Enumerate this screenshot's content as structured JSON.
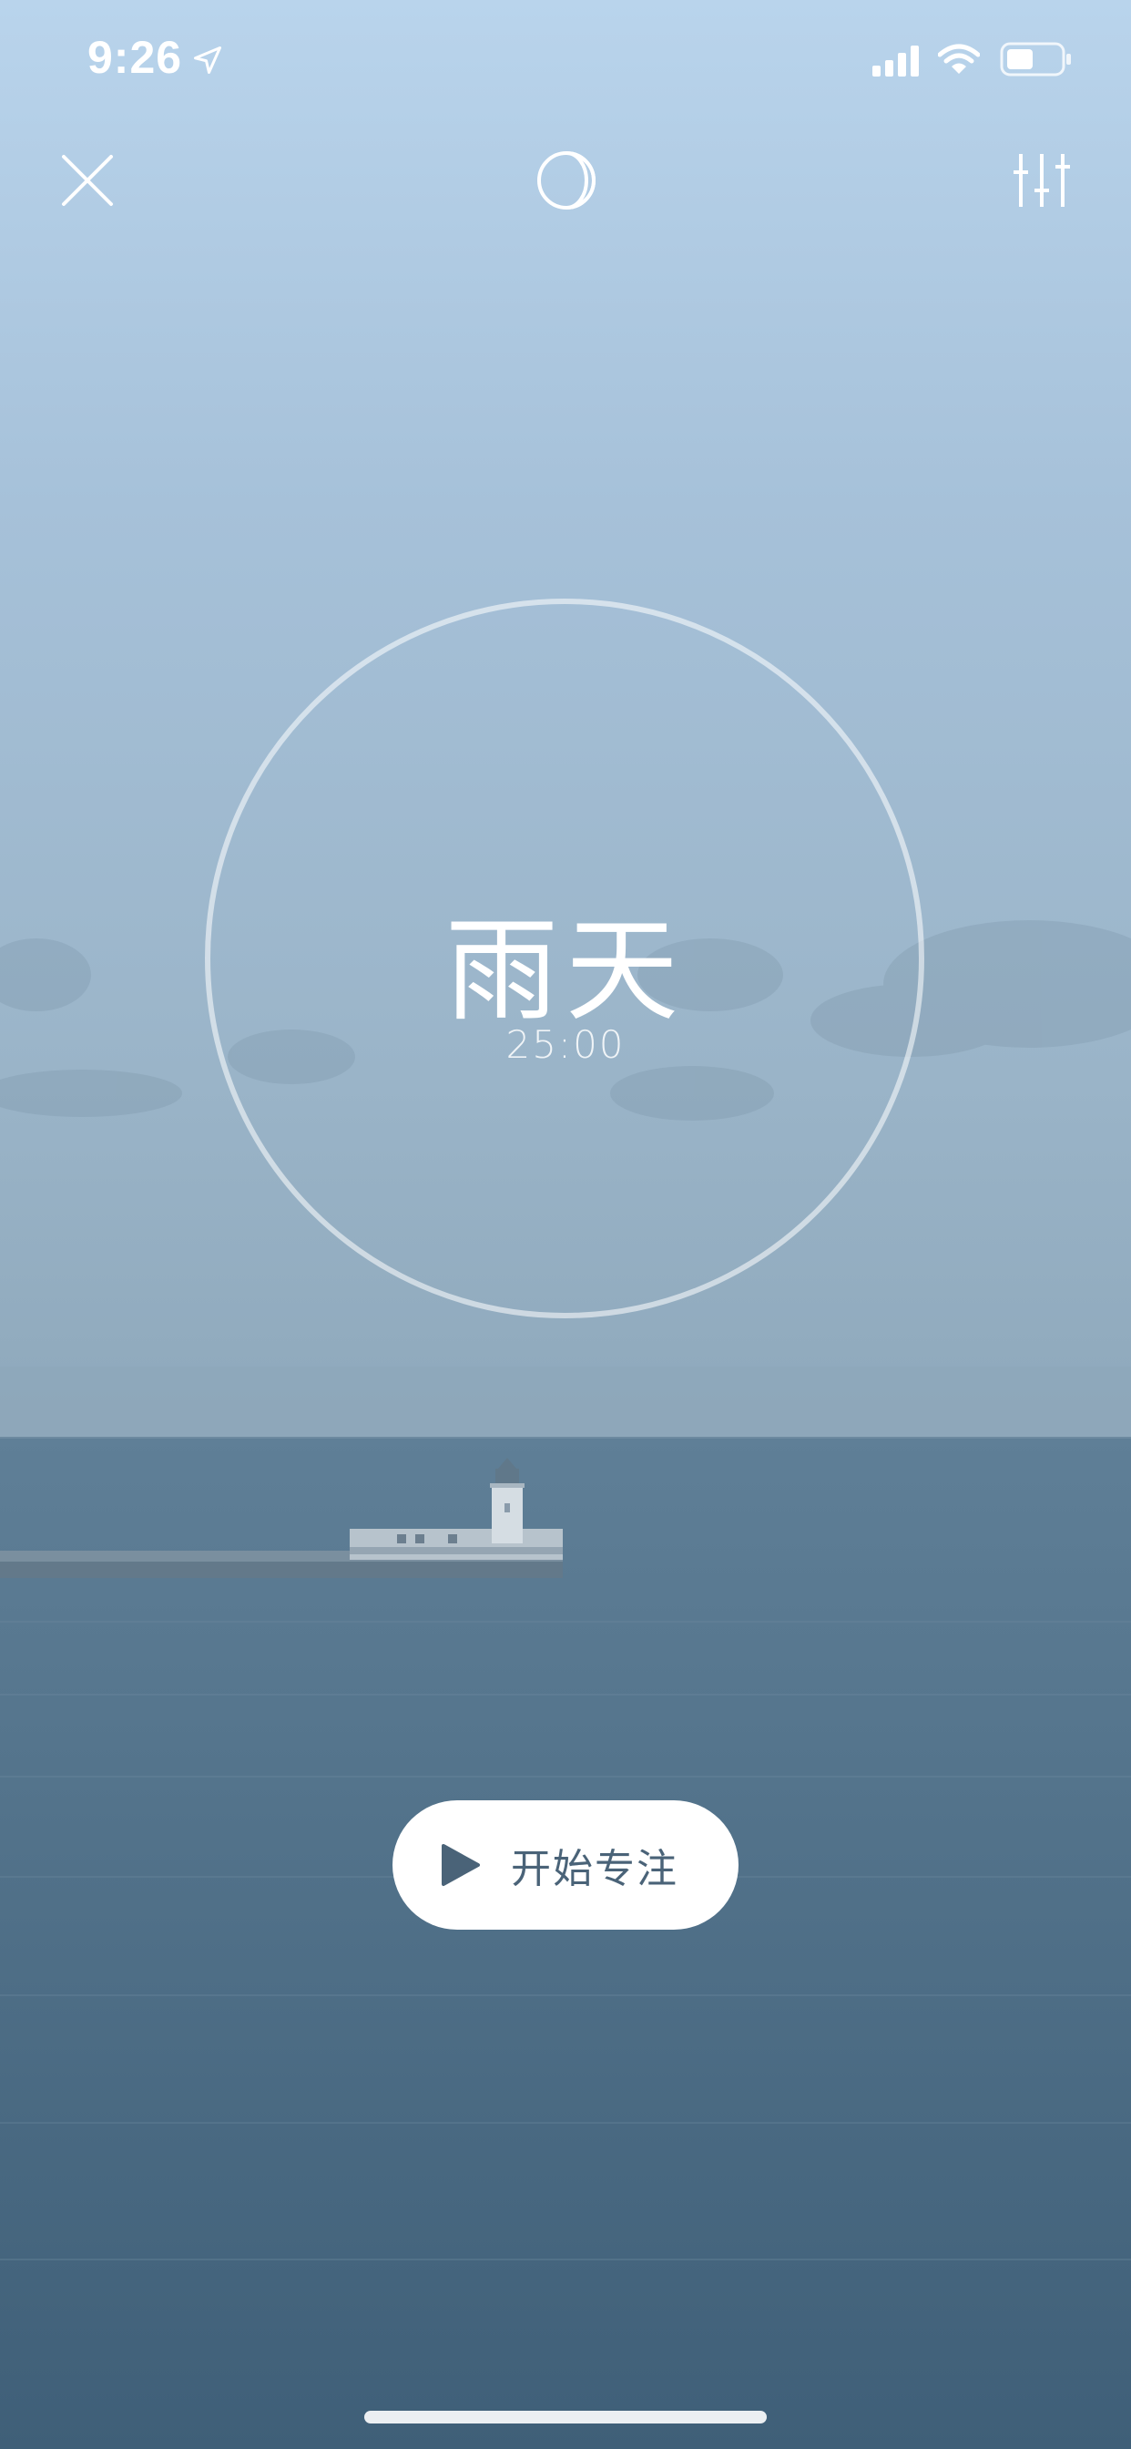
{
  "status_bar": {
    "time": "9:26",
    "icons": [
      "location-arrow-icon",
      "cellular-signal-icon",
      "wifi-icon",
      "battery-icon"
    ]
  },
  "top_nav": {
    "icons": [
      "close-icon",
      "theme-moon-icon",
      "sliders-icon"
    ]
  },
  "timer": {
    "sound_name": "雨天",
    "duration": "25:00"
  },
  "start_button": {
    "label": "开始专注",
    "icon": "play-icon"
  },
  "colors": {
    "sky_top": "#b9d4ec",
    "sky_bottom": "#8fa9bd",
    "sea": "#47677f",
    "button_text": "#4a6378",
    "icon": "#ffffff"
  }
}
